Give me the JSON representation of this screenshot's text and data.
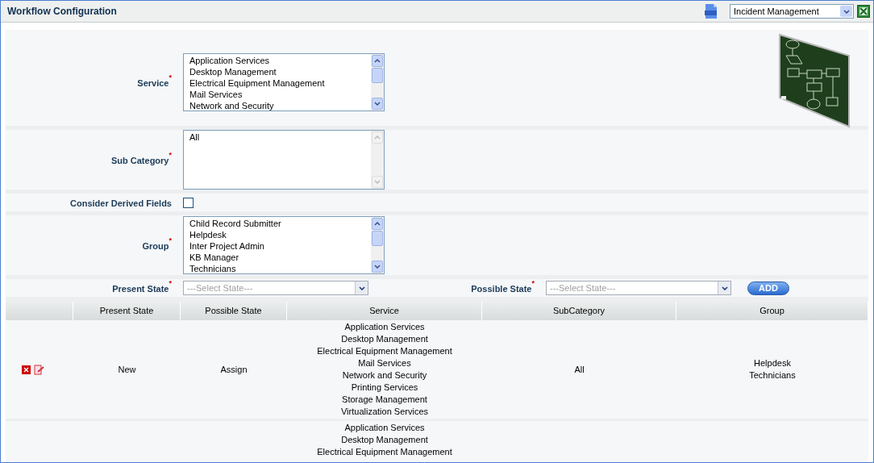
{
  "header": {
    "title": "Workflow Configuration",
    "module_select": {
      "value": "Incident Management"
    }
  },
  "form": {
    "service": {
      "label": "Service",
      "required_mark": "*",
      "options": [
        "Application Services",
        "Desktop Management",
        "Electrical Equipment Management",
        "Mail Services",
        "Network and Security"
      ]
    },
    "sub_category": {
      "label": "Sub Category",
      "required_mark": "*",
      "options": [
        "All"
      ]
    },
    "derived_fields": {
      "label": "Consider Derived Fields",
      "checked": false
    },
    "group": {
      "label": "Group",
      "required_mark": "*",
      "options": [
        "Child Record Submitter",
        "Helpdesk",
        "Inter Project Admin",
        "KB Manager",
        "Technicians"
      ]
    },
    "present_state": {
      "label": "Present State",
      "required_mark": "*",
      "placeholder": "---Select State---"
    },
    "possible_state": {
      "label": "Possible State",
      "required_mark": "*",
      "placeholder": "---Select State---"
    },
    "add_button": "ADD"
  },
  "table": {
    "columns": [
      "",
      "Present State",
      "Possible State",
      "Service",
      "SubCategory",
      "Group"
    ],
    "rows": [
      {
        "present_state": "New",
        "possible_state": "Assign",
        "services": [
          "Application Services",
          "Desktop Management",
          "Electrical Equipment Management",
          "Mail Services",
          "Network and Security",
          "Printing Services",
          "Storage Management",
          "Virtualization Services"
        ],
        "sub_category": "All",
        "groups": [
          "Helpdesk",
          "Technicians"
        ],
        "actions": true
      },
      {
        "services": [
          "Application Services",
          "Desktop Management",
          "Electrical Equipment Management"
        ],
        "actions": false
      }
    ]
  }
}
